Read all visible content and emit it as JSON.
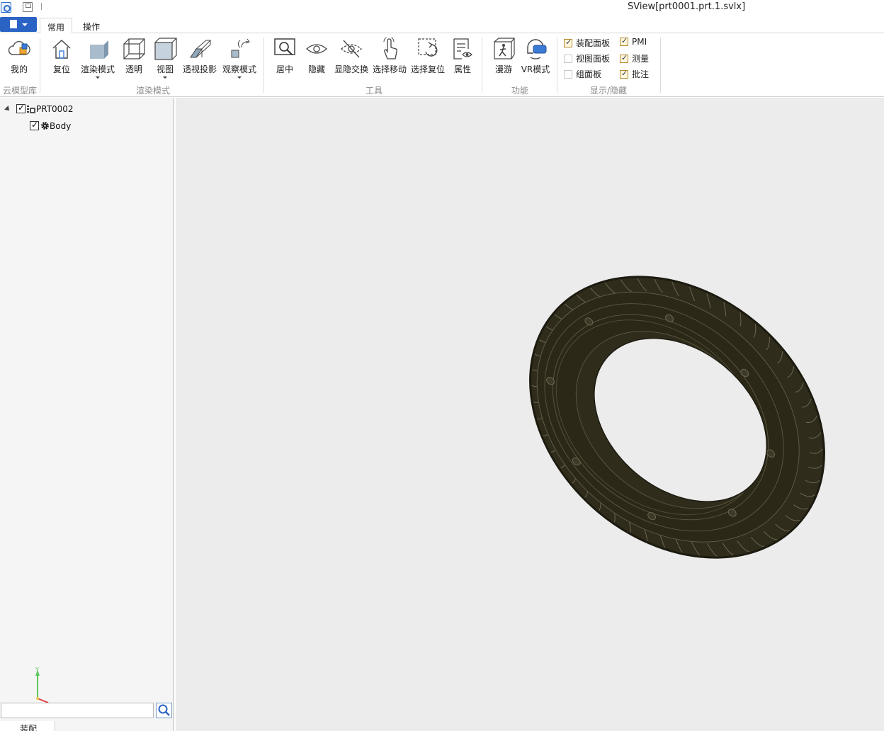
{
  "window": {
    "title": "SView[prt0001.prt.1.svlx]"
  },
  "tabs": [
    {
      "label": "常用",
      "active": true
    },
    {
      "label": "操作",
      "active": false
    }
  ],
  "ribbon": {
    "cloud": {
      "my_label": "我的",
      "group_label": "云模型库"
    },
    "render": {
      "reset_label": "复位",
      "render_mode_label": "渲染模式",
      "transparent_label": "透明",
      "view_label": "视图",
      "perspective_label": "透视投影",
      "observe_mode_label": "观察模式",
      "group_label": "渲染模式"
    },
    "tools": {
      "center_label": "居中",
      "hide_label": "隐藏",
      "toggle_hide_label": "显隐交换",
      "select_move_label": "选择移动",
      "select_reset_label": "选择复位",
      "properties_label": "属性",
      "group_label": "工具"
    },
    "features": {
      "walk_label": "漫游",
      "vr_label": "VR模式",
      "group_label": "功能"
    },
    "display": {
      "group_label": "显示/隐藏",
      "assembly_panel": {
        "label": "装配面板",
        "checked": true
      },
      "view_panel": {
        "label": "视图面板",
        "checked": false
      },
      "group_panel": {
        "label": "组面板",
        "checked": false
      },
      "pmi": {
        "label": "PMI",
        "checked": true
      },
      "measure": {
        "label": "测量",
        "checked": true
      },
      "annotation": {
        "label": "批注",
        "checked": true
      }
    }
  },
  "tree": {
    "root": {
      "label": "PRT0002",
      "checked": true,
      "icon": "assembly-icon"
    },
    "children": [
      {
        "label": "Body",
        "checked": true,
        "icon": "gear-icon"
      }
    ]
  },
  "panel": {
    "search_placeholder": "",
    "bottom_tab_label": "装配"
  },
  "colors": {
    "accent": "#2b63c5",
    "viewport_bg": "#ececec",
    "model": "#2f2c1c",
    "model_edge": "#6b6754"
  },
  "model": {
    "name": "tire",
    "tread_count": 52
  }
}
